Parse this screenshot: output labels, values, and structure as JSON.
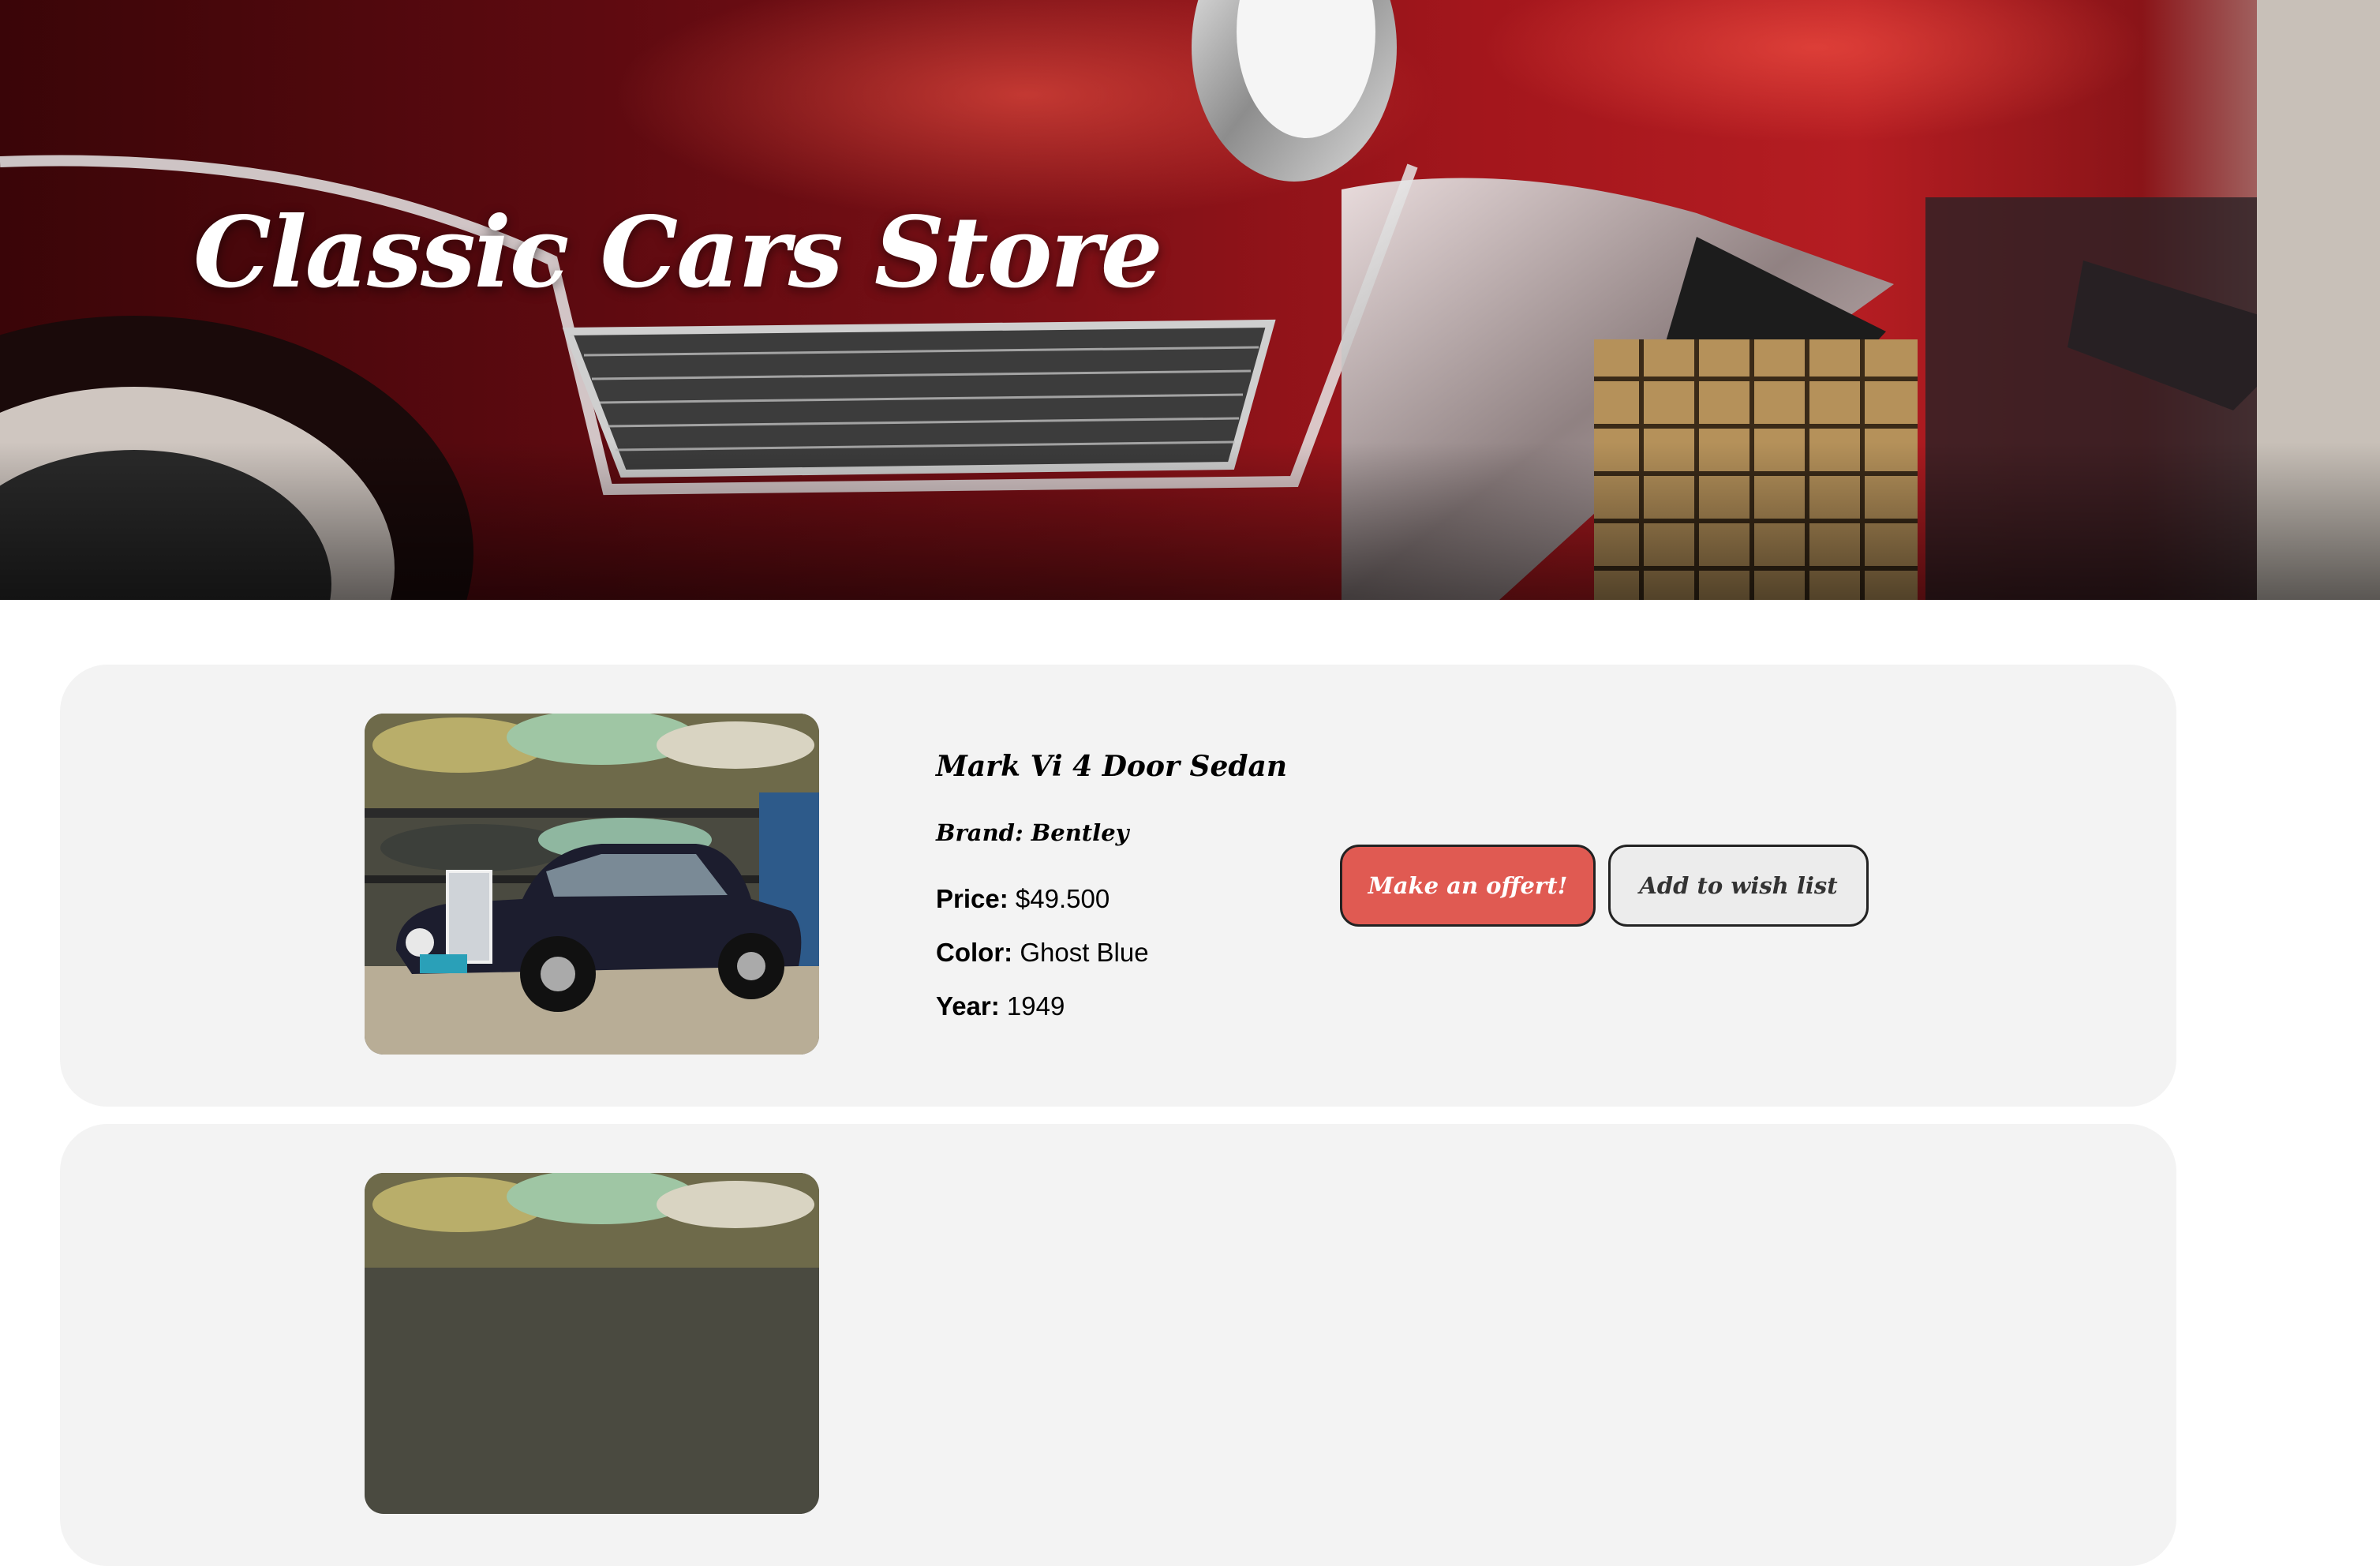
{
  "hero": {
    "title": "Classic Cars Store",
    "image": "red-classic-car-closeup"
  },
  "listings": [
    {
      "model": "Mark Vi 4 Door Sedan",
      "brand_text": "Brand: Bentley",
      "price_label": "Price:",
      "price_value": "$49.500",
      "color_label": "Color:",
      "color_value": "Ghost Blue",
      "year_label": "Year:",
      "year_value": "1949",
      "offer_button": "Make an offert!",
      "wishlist_button": "Add to wish list",
      "photo": "dark-blue-vintage-sedan-in-garage"
    }
  ],
  "colors": {
    "offer_button": "#e05a52",
    "wishlist_button": "#ececec",
    "card_background": "#f3f3f3"
  }
}
